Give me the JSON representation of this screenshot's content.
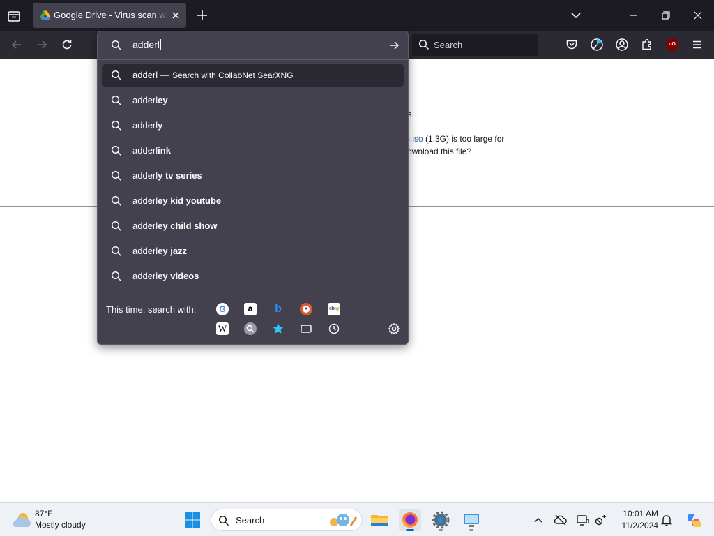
{
  "window": {
    "tab_title": "Google Drive - Virus scan warning",
    "colors": {
      "tabstrip": "#1c1b22",
      "toolbar": "#2b2a33",
      "popup": "#42414d",
      "accent": "#0067c0"
    }
  },
  "toolbar": {
    "search_placeholder": "Search",
    "icons": [
      "back-icon",
      "forward-icon",
      "reload-icon",
      "pocket-icon",
      "sync-icon",
      "account-icon",
      "extensions-icon",
      "ublock-icon",
      "menu-icon"
    ],
    "ublock_label": "uO"
  },
  "page": {
    "fragment_1": "s.",
    "fragment_2_link": ").iso",
    "fragment_2_rest": " (1.3G) is too large for",
    "fragment_3": "ownload this file?"
  },
  "urlbar": {
    "input_value": "adderl",
    "results": [
      {
        "typed": "adderl",
        "completion": "",
        "separator": "—",
        "action": "Search with CollabNet SearXNG",
        "selected": true
      },
      {
        "typed": "adderl",
        "completion": "ey"
      },
      {
        "typed": "adderl",
        "completion": "y"
      },
      {
        "typed": "adderl",
        "completion": "ink"
      },
      {
        "typed": "adderl",
        "completion": "y tv series"
      },
      {
        "typed": "adderl",
        "completion": "ey kid youtube"
      },
      {
        "typed": "adderl",
        "completion": "ey child show"
      },
      {
        "typed": "adderl",
        "completion": "ey jazz"
      },
      {
        "typed": "adderl",
        "completion": "ey videos"
      }
    ],
    "one_off_label": "This time, search with:",
    "engines": [
      "google-icon",
      "amazon-icon",
      "bing-icon",
      "duckduckgo-icon",
      "ebay-icon",
      "wikipedia-icon",
      "searxng-icon"
    ],
    "engine_glyphs": {
      "google": "G",
      "amazon": "a",
      "bing": "b",
      "ebay": "ebay",
      "wikipedia": "W"
    },
    "modes": [
      "bookmarks-icon",
      "tabs-icon",
      "history-icon",
      "settings-gear-icon"
    ]
  },
  "taskbar": {
    "weather_temp": "87°F",
    "weather_desc": "Mostly cloudy",
    "search_placeholder": "Search",
    "apps": [
      "file-explorer-icon",
      "firefox-icon",
      "settings-icon",
      "remote-desktop-icon"
    ],
    "tray": [
      "chevron-up-icon",
      "onedrive-offline-icon",
      "display-icon",
      "wifi-off-icon",
      "bell-icon",
      "copilot-icon"
    ],
    "time": "10:01 AM",
    "date": "11/2/2024"
  }
}
